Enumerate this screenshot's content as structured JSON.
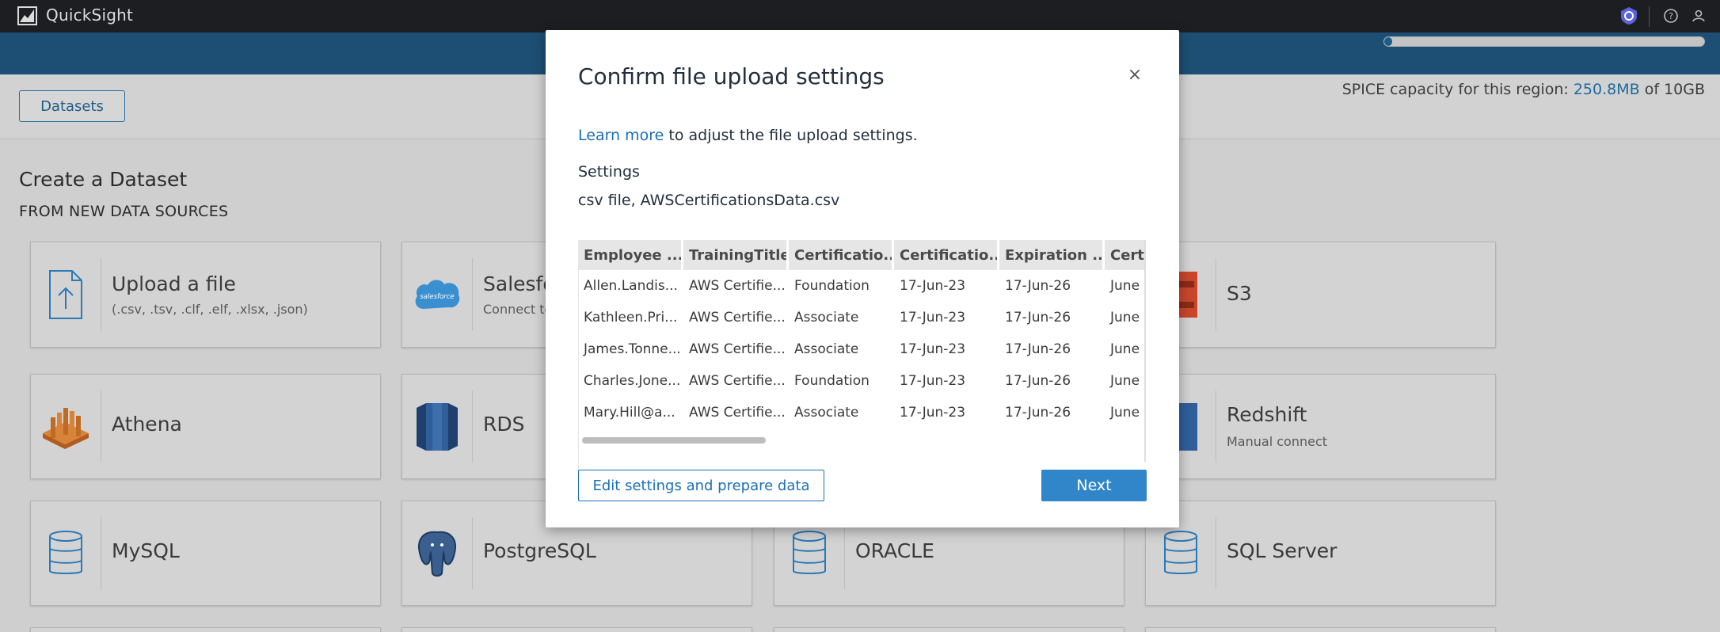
{
  "app": {
    "name": "QuickSight"
  },
  "header": {
    "datasets_button": "Datasets"
  },
  "spice": {
    "prefix": "SPICE capacity for this region: ",
    "used": "250.8MB",
    "of_text": " of 10GB",
    "used_fraction": 0.0245
  },
  "main": {
    "title": "Create a Dataset",
    "subtitle": "FROM NEW DATA SOURCES",
    "cards": [
      {
        "label": "Upload a file",
        "desc": "(.csv, .tsv, .clf, .elf, .xlsx, .json)",
        "icon": "upload-file-icon"
      },
      {
        "label": "Salesforce",
        "desc": "Connect to",
        "icon": "salesforce-icon"
      },
      {
        "label": "S3",
        "desc": "",
        "icon": "s3-icon"
      },
      {
        "label": "Athena",
        "desc": "",
        "icon": "athena-icon"
      },
      {
        "label": "RDS",
        "desc": "",
        "icon": "rds-icon"
      },
      {
        "label": "Redshift",
        "desc": "Manual connect",
        "icon": "redshift-icon"
      },
      {
        "label": "MySQL",
        "desc": "",
        "icon": "database-icon"
      },
      {
        "label": "PostgreSQL",
        "desc": "",
        "icon": "postgresql-icon"
      },
      {
        "label": "ORACLE",
        "desc": "",
        "icon": "database-icon"
      },
      {
        "label": "SQL Server",
        "desc": "",
        "icon": "database-icon"
      }
    ]
  },
  "modal": {
    "title": "Confirm file upload settings",
    "close_glyph": "×",
    "learn_more": "Learn more",
    "learn_rest": " to adjust the file upload settings.",
    "settings_label": "Settings",
    "file_desc": "csv file, AWSCertificationsData.csv",
    "columns": [
      "Employee ...",
      "TrainingTitle",
      "Certificatio...",
      "Certificatio...",
      "Expiration ...",
      "Certi"
    ],
    "rows": [
      [
        "Allen.Landis...",
        "AWS Certifie...",
        "Foundation",
        "17-Jun-23",
        "17-Jun-26",
        "June"
      ],
      [
        "Kathleen.Pri...",
        "AWS Certifie...",
        "Associate",
        "17-Jun-23",
        "17-Jun-26",
        "June"
      ],
      [
        "James.Tonne...",
        "AWS Certifie...",
        "Associate",
        "17-Jun-23",
        "17-Jun-26",
        "June"
      ],
      [
        "Charles.Jone...",
        "AWS Certifie...",
        "Foundation",
        "17-Jun-23",
        "17-Jun-26",
        "June"
      ],
      [
        "Mary.Hill@a...",
        "AWS Certifie...",
        "Associate",
        "17-Jun-23",
        "17-Jun-26",
        "June"
      ]
    ],
    "edit_button": "Edit settings and prepare data",
    "next_button": "Next"
  },
  "colors": {
    "accent": "#1b70b8",
    "primary_button": "#3086c8",
    "topbar": "#1d1e22",
    "band": "#1c4f73"
  }
}
